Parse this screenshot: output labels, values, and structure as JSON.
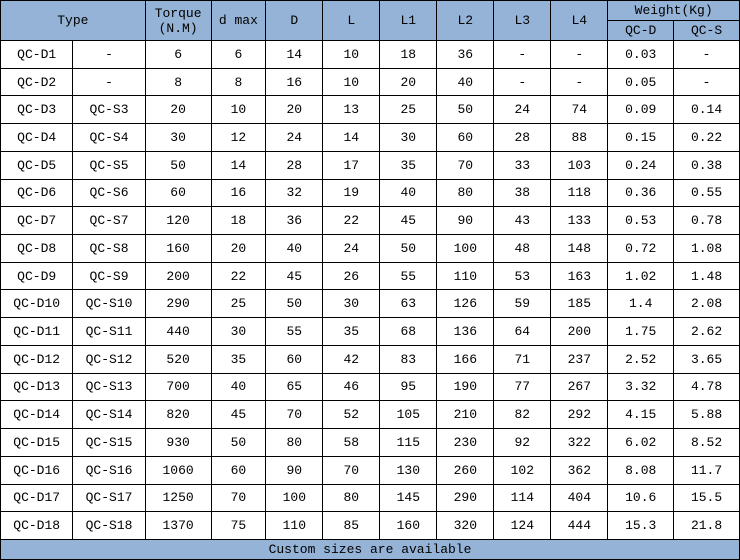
{
  "chart_data": {
    "type": "table",
    "title": "",
    "columns": [
      "Type-D",
      "Type-S",
      "Torque (N.M)",
      "d max",
      "D",
      "L",
      "L1",
      "L2",
      "L3",
      "L4",
      "Weight(Kg) QC-D",
      "Weight(Kg) QC-S"
    ],
    "rows": [
      [
        "QC-D1",
        "-",
        "6",
        "6",
        "14",
        "10",
        "18",
        "36",
        "-",
        "-",
        "0.03",
        "-"
      ],
      [
        "QC-D2",
        "-",
        "8",
        "8",
        "16",
        "10",
        "20",
        "40",
        "-",
        "-",
        "0.05",
        "-"
      ],
      [
        "QC-D3",
        "QC-S3",
        "20",
        "10",
        "20",
        "13",
        "25",
        "50",
        "24",
        "74",
        "0.09",
        "0.14"
      ],
      [
        "QC-D4",
        "QC-S4",
        "30",
        "12",
        "24",
        "14",
        "30",
        "60",
        "28",
        "88",
        "0.15",
        "0.22"
      ],
      [
        "QC-D5",
        "QC-S5",
        "50",
        "14",
        "28",
        "17",
        "35",
        "70",
        "33",
        "103",
        "0.24",
        "0.38"
      ],
      [
        "QC-D6",
        "QC-S6",
        "60",
        "16",
        "32",
        "19",
        "40",
        "80",
        "38",
        "118",
        "0.36",
        "0.55"
      ],
      [
        "QC-D7",
        "QC-S7",
        "120",
        "18",
        "36",
        "22",
        "45",
        "90",
        "43",
        "133",
        "0.53",
        "0.78"
      ],
      [
        "QC-D8",
        "QC-S8",
        "160",
        "20",
        "40",
        "24",
        "50",
        "100",
        "48",
        "148",
        "0.72",
        "1.08"
      ],
      [
        "QC-D9",
        "QC-S9",
        "200",
        "22",
        "45",
        "26",
        "55",
        "110",
        "53",
        "163",
        "1.02",
        "1.48"
      ],
      [
        "QC-D10",
        "QC-S10",
        "290",
        "25",
        "50",
        "30",
        "63",
        "126",
        "59",
        "185",
        "1.4",
        "2.08"
      ],
      [
        "QC-D11",
        "QC-S11",
        "440",
        "30",
        "55",
        "35",
        "68",
        "136",
        "64",
        "200",
        "1.75",
        "2.62"
      ],
      [
        "QC-D12",
        "QC-S12",
        "520",
        "35",
        "60",
        "42",
        "83",
        "166",
        "71",
        "237",
        "2.52",
        "3.65"
      ],
      [
        "QC-D13",
        "QC-S13",
        "700",
        "40",
        "65",
        "46",
        "95",
        "190",
        "77",
        "267",
        "3.32",
        "4.78"
      ],
      [
        "QC-D14",
        "QC-S14",
        "820",
        "45",
        "70",
        "52",
        "105",
        "210",
        "82",
        "292",
        "4.15",
        "5.88"
      ],
      [
        "QC-D15",
        "QC-S15",
        "930",
        "50",
        "80",
        "58",
        "115",
        "230",
        "92",
        "322",
        "6.02",
        "8.52"
      ],
      [
        "QC-D16",
        "QC-S16",
        "1060",
        "60",
        "90",
        "70",
        "130",
        "260",
        "102",
        "362",
        "8.08",
        "11.7"
      ],
      [
        "QC-D17",
        "QC-S17",
        "1250",
        "70",
        "100",
        "80",
        "145",
        "290",
        "114",
        "404",
        "10.6",
        "15.5"
      ],
      [
        "QC-D18",
        "QC-S18",
        "1370",
        "75",
        "110",
        "85",
        "160",
        "320",
        "124",
        "444",
        "15.3",
        "21.8"
      ]
    ]
  },
  "headers": {
    "type": "Type",
    "torque_top": "Torque",
    "torque_bot": "(N.M)",
    "dmax": "d max",
    "D": "D",
    "L": "L",
    "L1": "L1",
    "L2": "L2",
    "L3": "L3",
    "L4": "L4",
    "weight": "Weight(Kg)",
    "qcd": "QC-D",
    "qcs": "QC-S"
  },
  "footer": "Custom sizes are available"
}
